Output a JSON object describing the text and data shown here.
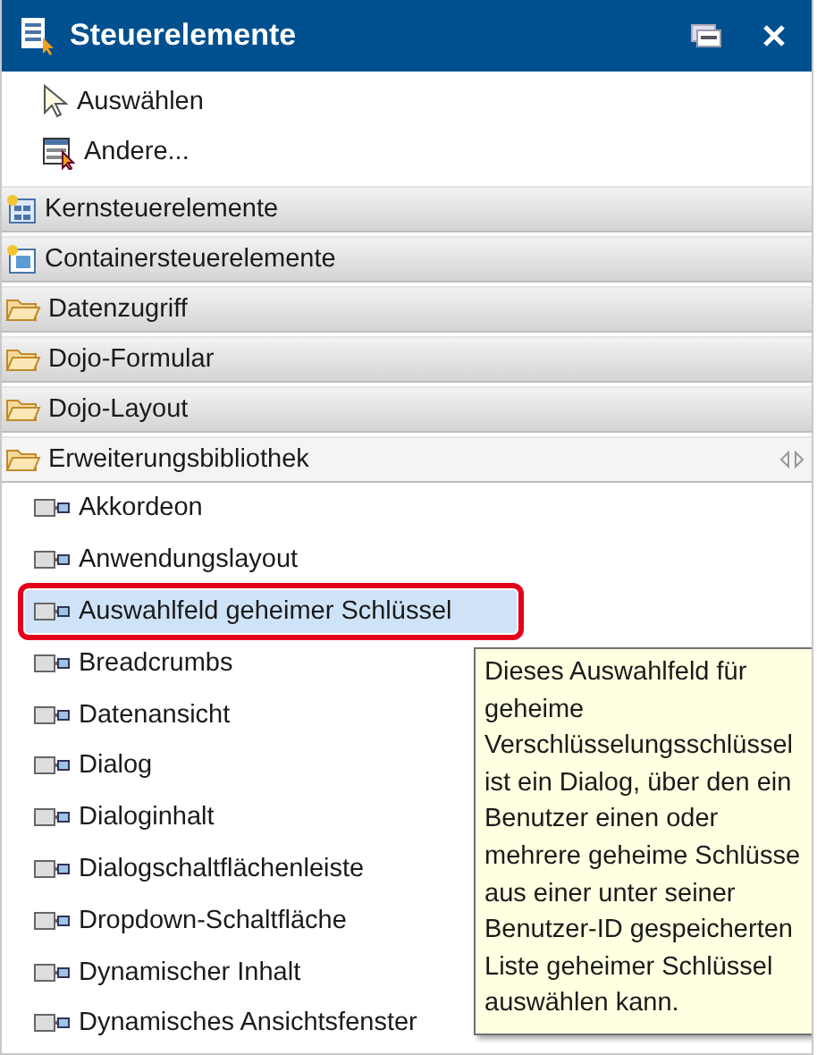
{
  "window": {
    "title": "Steuerelemente"
  },
  "tools": [
    {
      "label": "Auswählen",
      "kind": "pointer"
    },
    {
      "label": "Andere...",
      "kind": "other"
    }
  ],
  "drawers": [
    {
      "label": "Kernsteuerelemente",
      "kind": "core",
      "expanded": false
    },
    {
      "label": "Containersteuerelemente",
      "kind": "container",
      "expanded": false
    },
    {
      "label": "Datenzugriff",
      "kind": "folder",
      "expanded": false
    },
    {
      "label": "Dojo-Formular",
      "kind": "folder",
      "expanded": false
    },
    {
      "label": "Dojo-Layout",
      "kind": "folder",
      "expanded": false
    },
    {
      "label": "Erweiterungsbibliothek",
      "kind": "folder",
      "expanded": true,
      "items": [
        {
          "label": "Akkordeon",
          "selected": false,
          "highlighted": false
        },
        {
          "label": "Anwendungslayout",
          "selected": false,
          "highlighted": false
        },
        {
          "label": "Auswahlfeld geheimer Schlüssel",
          "selected": true,
          "highlighted": true
        },
        {
          "label": "Breadcrumbs",
          "selected": false,
          "highlighted": false
        },
        {
          "label": "Datenansicht",
          "selected": false,
          "highlighted": false
        },
        {
          "label": "Dialog",
          "selected": false,
          "highlighted": false
        },
        {
          "label": "Dialoginhalt",
          "selected": false,
          "highlighted": false
        },
        {
          "label": "Dialogschaltflächenleiste",
          "selected": false,
          "highlighted": false
        },
        {
          "label": "Dropdown-Schaltfläche",
          "selected": false,
          "highlighted": false
        },
        {
          "label": "Dynamischer Inhalt",
          "selected": false,
          "highlighted": false
        },
        {
          "label": "Dynamisches Ansichtsfenster",
          "selected": false,
          "highlighted": false
        }
      ]
    }
  ],
  "tooltip": {
    "text": "Dieses Auswahlfeld für geheime Verschlüsselungsschlüssel ist ein Dialog, über den ein Benutzer einen oder mehrere geheime Schlüsse aus einer unter seiner Benutzer-ID gespeicherten Liste geheimer Schlüssel auswählen kann."
  }
}
